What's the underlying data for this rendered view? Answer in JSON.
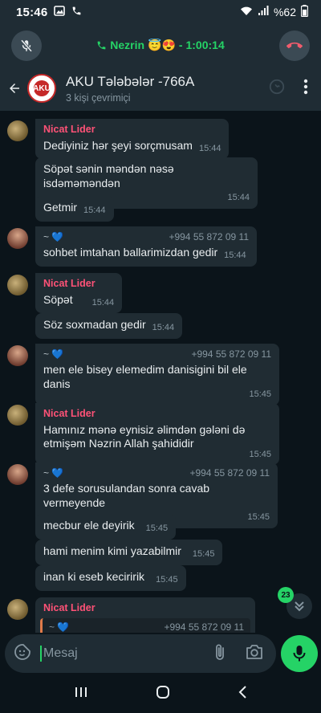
{
  "status_bar": {
    "time": "15:46",
    "battery": "%62"
  },
  "call": {
    "name": "Nezrin",
    "emoji": "😇😍",
    "duration": "- 1:00:14"
  },
  "header": {
    "title": "AKU Tələbələr -766A",
    "subtitle": "3 kişi çevrimiçi",
    "avatar_text": "AKU"
  },
  "messages": [
    {
      "sender": "Nicat Lider",
      "text": "Dediyiniz hər şeyi sorçmusam",
      "time": "15:44"
    },
    {
      "text": "Söpət sənin məndən nəsə isdəməməndən",
      "time": "15:44"
    },
    {
      "text": "Getmir",
      "time": "15:44"
    },
    {
      "sender": "~ 💙",
      "phone": "+994 55 872 09 11",
      "text": "sohbet imtahan ballarimizdan gedir",
      "time": "15:44"
    },
    {
      "sender": "Nicat Lider",
      "text": "Söpət",
      "time": "15:44"
    },
    {
      "text": "Söz soxmadan gedir",
      "time": "15:44"
    },
    {
      "sender": "~ 💙",
      "phone": "+994 55 872 09 11",
      "text": "men ele bisey elemedim danisigini bil ele danis",
      "time": "15:45"
    },
    {
      "sender": "Nicat Lider",
      "text": "Hamınız mənə eynisiz əlimdən gələni də etmişəm Nəzrin Allah şahididir",
      "time": "15:45"
    },
    {
      "sender": "~ 💙",
      "phone": "+994 55 872 09 11",
      "text": "3 defe sorusulandan sonra cavab vermeyende",
      "time": "15:45"
    },
    {
      "text": "mecbur ele deyirik",
      "time": "15:45"
    },
    {
      "text": "hami menim kimi yazabilmir",
      "time": "15:45"
    },
    {
      "text": "inan ki eseb keciririk",
      "time": "15:45"
    },
    {
      "sender": "Nicat Lider",
      "quote_sender": "~ 💙",
      "quote_phone": "+994 55 872 09 11"
    }
  ],
  "unread_count": "23",
  "composer": {
    "placeholder": "Mesaj"
  },
  "colors": {
    "background": "#0b141a",
    "bubble": "#202c33",
    "accent": "#25d366",
    "sender_name": "#ff5277",
    "end_call": "#f15c6d"
  }
}
